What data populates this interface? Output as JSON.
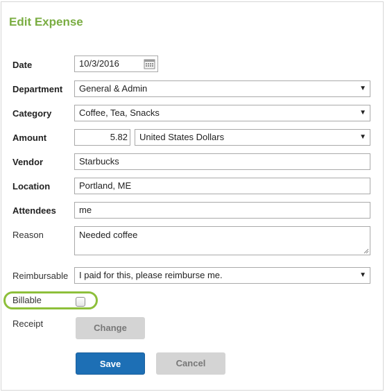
{
  "dialog": {
    "title": "Edit Expense"
  },
  "form": {
    "date": {
      "label": "Date",
      "value": "10/3/2016"
    },
    "department": {
      "label": "Department",
      "value": "General & Admin"
    },
    "category": {
      "label": "Category",
      "value": "Coffee, Tea, Snacks"
    },
    "amount": {
      "label": "Amount",
      "value": "5.82",
      "currency": "United States Dollars"
    },
    "vendor": {
      "label": "Vendor",
      "value": "Starbucks"
    },
    "location": {
      "label": "Location",
      "value": "Portland, ME"
    },
    "attendees": {
      "label": "Attendees",
      "value": "me"
    },
    "reason": {
      "label": "Reason",
      "value": "Needed coffee"
    },
    "reimbursable": {
      "label": "Reimbursable",
      "value": "I paid for this, please reimburse me."
    },
    "billable": {
      "label": "Billable",
      "checked": false
    },
    "receipt": {
      "label": "Receipt",
      "button": "Change"
    }
  },
  "actions": {
    "save": "Save",
    "cancel": "Cancel"
  },
  "icons": {
    "calendar": "calendar-icon",
    "dropdown": "▼"
  },
  "colors": {
    "title": "#7aad42",
    "highlight": "#8dbf3a",
    "primary": "#1d6fb5"
  }
}
